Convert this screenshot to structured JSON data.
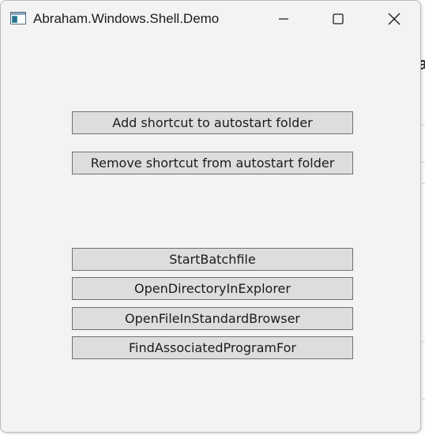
{
  "window": {
    "title": "Abraham.Windows.Shell.Demo"
  },
  "caption_buttons": {
    "minimize_icon": "minimize-icon",
    "maximize_icon": "maximize-icon",
    "close_icon": "close-icon"
  },
  "buttons": [
    {
      "label": "Add shortcut to autostart folder"
    },
    {
      "label": "Remove shortcut from autostart folder"
    },
    {
      "label": "StartBatchfile"
    },
    {
      "label": "OpenDirectoryInExplorer"
    },
    {
      "label": "OpenFileInStandardBrowser"
    },
    {
      "label": "FindAssociatedProgramFor"
    }
  ],
  "colors": {
    "window_bg": "#f3f3f3",
    "button_bg": "#dddddd",
    "button_border": "#707070"
  }
}
